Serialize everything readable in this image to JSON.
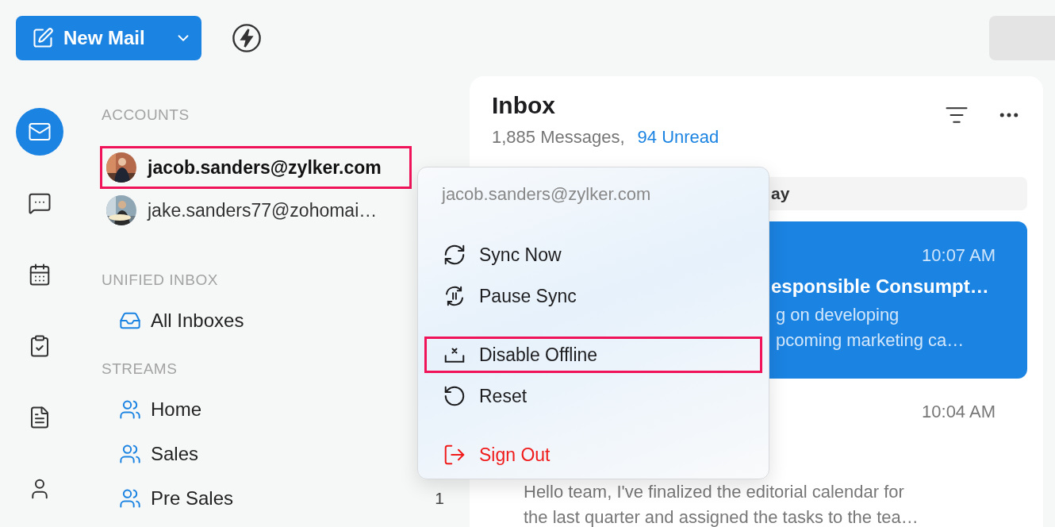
{
  "toolbar": {
    "new_mail": "New Mail"
  },
  "rail": [
    {
      "kind": "mail",
      "selected": true
    },
    {
      "kind": "chat",
      "selected": false
    },
    {
      "kind": "calendar",
      "selected": false
    },
    {
      "kind": "tasks",
      "selected": false
    },
    {
      "kind": "notes",
      "selected": false
    },
    {
      "kind": "contacts",
      "selected": false
    }
  ],
  "accounts_heading": "ACCOUNTS",
  "accounts": [
    {
      "email": "jacob.sanders@zylker.com",
      "highlighted": true
    },
    {
      "email": "jake.sanders77@zohomai…",
      "highlighted": false
    }
  ],
  "sections": [
    {
      "heading": "UNIFIED INBOX",
      "items": [
        {
          "kind": "inbox",
          "label": "All Inboxes"
        }
      ]
    },
    {
      "heading": "STREAMS",
      "items": [
        {
          "kind": "stream",
          "label": "Home"
        },
        {
          "kind": "stream",
          "label": "Sales"
        },
        {
          "kind": "stream",
          "label": "Pre Sales",
          "count": "1"
        }
      ]
    }
  ],
  "inbox": {
    "title": "Inbox",
    "messages_count": "1,885 Messages,",
    "unread": "94 Unread"
  },
  "date_group": "ay",
  "messages": [
    {
      "selected": true,
      "time": "10:07 AM",
      "subject": "esponsible Consumpt…",
      "preview": [
        "g on developing",
        "pcoming marketing ca…"
      ]
    },
    {
      "selected": false,
      "time": "10:04 AM",
      "preview": [
        "Hello team, I've finalized the editorial calendar for",
        "the last quarter and assigned the tasks to the tea…"
      ]
    }
  ],
  "context_menu": {
    "title": "jacob.sanders@zylker.com",
    "groups": [
      [
        {
          "kind": "sync",
          "label": "Sync Now",
          "highlighted": false
        },
        {
          "kind": "pause",
          "label": "Pause Sync",
          "highlighted": false
        }
      ],
      [
        {
          "kind": "offline",
          "label": "Disable Offline",
          "highlighted": true
        },
        {
          "kind": "reset",
          "label": "Reset",
          "highlighted": false
        }
      ],
      [
        {
          "kind": "signout",
          "label": "Sign Out",
          "highlighted": false
        }
      ]
    ]
  }
}
